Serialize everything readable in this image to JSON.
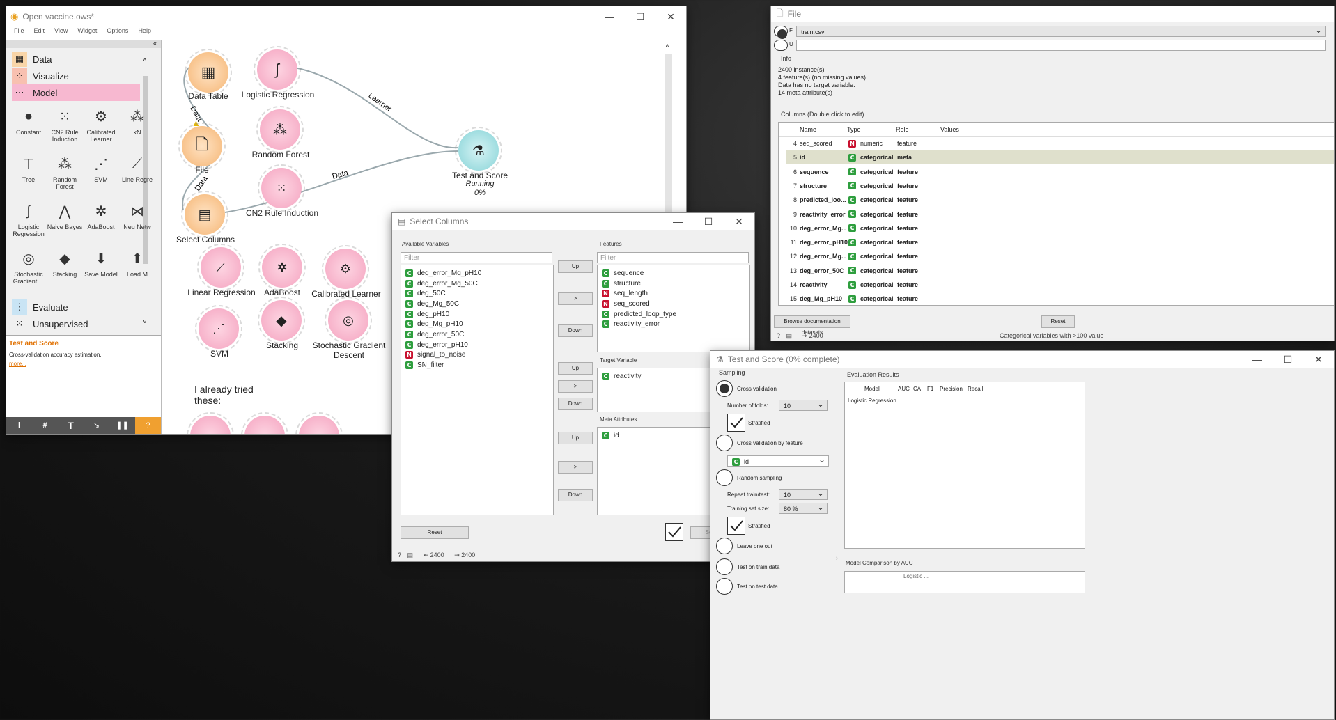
{
  "main": {
    "title": "Open vaccine.ows*",
    "menu": [
      "File",
      "Edit",
      "View",
      "Widget",
      "Options",
      "Help"
    ],
    "categories": [
      {
        "label": "Data",
        "icon": "data-table-icon"
      },
      {
        "label": "Visualize",
        "icon": "scatter-icon"
      },
      {
        "label": "Model",
        "icon": "model-icon"
      }
    ],
    "bottom_categories": [
      {
        "label": "Evaluate",
        "icon": "evaluate-icon"
      },
      {
        "label": "Unsupervised",
        "icon": "cluster-icon"
      }
    ],
    "widgets": [
      {
        "label": "Constant"
      },
      {
        "label": "CN2 Rule Induction"
      },
      {
        "label": "Calibrated Learner"
      },
      {
        "label": "kN"
      },
      {
        "label": "Tree"
      },
      {
        "label": "Random Forest"
      },
      {
        "label": "SVM"
      },
      {
        "label": "Line Regre"
      },
      {
        "label": "Logistic Regression"
      },
      {
        "label": "Naive Bayes"
      },
      {
        "label": "AdaBoost"
      },
      {
        "label": "Neu Netw"
      },
      {
        "label": "Stochastic Gradient ..."
      },
      {
        "label": "Stacking"
      },
      {
        "label": "Save Model"
      },
      {
        "label": "Load M"
      }
    ],
    "help": {
      "title": "Test and Score",
      "desc": "Cross-validation accuracy estimation.",
      "more": "more..."
    },
    "toolbar_glyphs": [
      "i",
      "#",
      "T",
      "↘",
      "❚❚",
      "?"
    ],
    "canvas": {
      "nodes": {
        "data_table": "Data Table",
        "logistic": "Logistic Regression",
        "file": "File",
        "random_forest": "Random Forest",
        "cn2": "CN2 Rule Induction",
        "select_columns": "Select Columns",
        "test_score": "Test and Score",
        "test_score_status": "Running",
        "test_score_pct": "0%",
        "linear": "Linear Regression",
        "adaboost": "AdaBoost",
        "calibrated": "Calibrated Learner",
        "svm": "SVM",
        "stacking": "Stacking",
        "sgd": "Stochastic Gradient Descent"
      },
      "links": {
        "data1": "Data",
        "data2": "Data",
        "learner": "Learner",
        "data3": "Data"
      },
      "note": "I already tried these:"
    }
  },
  "file_win": {
    "title": "File",
    "file_value": "train.csv",
    "radio_labels": [
      "F",
      "U"
    ],
    "info_title": "Info",
    "info_lines": [
      "2400 instance(s)",
      "4 feature(s) (no missing values)",
      "Data has no target variable.",
      "14 meta attribute(s)"
    ],
    "columns_title": "Columns (Double click to edit)",
    "headers": [
      "Name",
      "Type",
      "Role",
      "Values"
    ],
    "rows": [
      {
        "n": "4",
        "name": "seq_scored",
        "badge": "N",
        "type": "numeric",
        "role": "feature",
        "bold": false
      },
      {
        "n": "5",
        "name": "id",
        "badge": "C",
        "type": "categorical",
        "role": "meta",
        "bold": true
      },
      {
        "n": "6",
        "name": "sequence",
        "badge": "C",
        "type": "categorical",
        "role": "feature",
        "bold": true
      },
      {
        "n": "7",
        "name": "structure",
        "badge": "C",
        "type": "categorical",
        "role": "feature",
        "bold": true
      },
      {
        "n": "8",
        "name": "predicted_loo...",
        "badge": "C",
        "type": "categorical",
        "role": "feature",
        "bold": true
      },
      {
        "n": "9",
        "name": "reactivity_error",
        "badge": "C",
        "type": "categorical",
        "role": "feature",
        "bold": true
      },
      {
        "n": "10",
        "name": "deg_error_Mg...",
        "badge": "C",
        "type": "categorical",
        "role": "feature",
        "bold": true
      },
      {
        "n": "11",
        "name": "deg_error_pH10",
        "badge": "C",
        "type": "categorical",
        "role": "feature",
        "bold": true
      },
      {
        "n": "12",
        "name": "deg_error_Mg...",
        "badge": "C",
        "type": "categorical",
        "role": "feature",
        "bold": true
      },
      {
        "n": "13",
        "name": "deg_error_50C",
        "badge": "C",
        "type": "categorical",
        "role": "feature",
        "bold": true
      },
      {
        "n": "14",
        "name": "reactivity",
        "badge": "C",
        "type": "categorical",
        "role": "feature",
        "bold": true
      },
      {
        "n": "15",
        "name": "deg_Mg_pH10",
        "badge": "C",
        "type": "categorical",
        "role": "feature",
        "bold": true
      }
    ],
    "browse": "Browse documentation datasets",
    "reset": "Reset",
    "status_count": "2400",
    "status_warning": "Categorical variables with >100 value"
  },
  "select_win": {
    "title": "Select Columns",
    "available_title": "Available Variables",
    "filter_placeholder": "Filter",
    "available": [
      {
        "b": "C",
        "t": "deg_error_Mg_pH10"
      },
      {
        "b": "C",
        "t": "deg_error_Mg_50C"
      },
      {
        "b": "C",
        "t": "deg_50C"
      },
      {
        "b": "C",
        "t": "deg_Mg_50C"
      },
      {
        "b": "C",
        "t": "deg_pH10"
      },
      {
        "b": "C",
        "t": "deg_Mg_pH10"
      },
      {
        "b": "C",
        "t": "deg_error_50C"
      },
      {
        "b": "C",
        "t": "deg_error_pH10"
      },
      {
        "b": "N",
        "t": "signal_to_noise"
      },
      {
        "b": "C",
        "t": "SN_filter"
      }
    ],
    "features_title": "Features",
    "features": [
      {
        "b": "C",
        "t": "sequence"
      },
      {
        "b": "C",
        "t": "structure"
      },
      {
        "b": "N",
        "t": "seq_length"
      },
      {
        "b": "N",
        "t": "seq_scored"
      },
      {
        "b": "C",
        "t": "predicted_loop_type"
      },
      {
        "b": "C",
        "t": "reactivity_error"
      }
    ],
    "target_title": "Target Variable",
    "target": [
      {
        "b": "C",
        "t": "reactivity"
      }
    ],
    "meta_title": "Meta Attributes",
    "meta": [
      {
        "b": "C",
        "t": "id"
      }
    ],
    "up": "Up",
    "down": "Down",
    "move": ">",
    "reset": "Reset",
    "send": "Send",
    "status_in": "2400",
    "status_out": "2400"
  },
  "test_win": {
    "title": "Test and Score (0% complete)",
    "sampling_title": "Sampling",
    "cv": "Cross validation",
    "folds_label": "Number of folds:",
    "folds_value": "10",
    "stratified": "Stratified",
    "cv_feature": "Cross validation by feature",
    "feature_value": "id",
    "random": "Random sampling",
    "repeat_label": "Repeat train/test:",
    "repeat_value": "10",
    "train_size_label": "Training set size:",
    "train_size_value": "80 %",
    "stratified2": "Stratified",
    "loo": "Leave one out",
    "train_data": "Test on train data",
    "test_data": "Test on test data",
    "eval_title": "Evaluation Results",
    "eval_headers": [
      "Model",
      "AUC",
      "CA",
      "F1",
      "Precision",
      "Recall"
    ],
    "eval_rows": [
      "Logistic Regression"
    ],
    "compare_title": "Model Comparison by AUC",
    "compare_header": "Logistic ..."
  }
}
